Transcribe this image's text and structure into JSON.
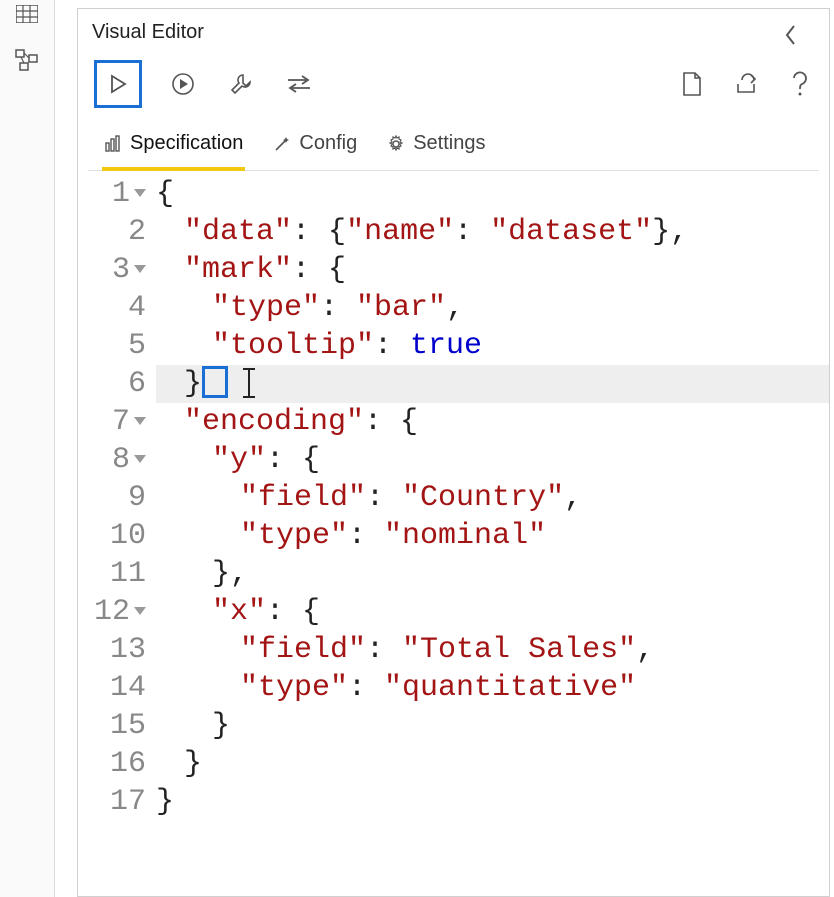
{
  "panel": {
    "title": "Visual Editor"
  },
  "tabs": {
    "specification": "Specification",
    "config": "Config",
    "settings": "Settings"
  },
  "code": {
    "lines": [
      {
        "n": "1",
        "fold": true
      },
      {
        "n": "2",
        "fold": false
      },
      {
        "n": "3",
        "fold": true
      },
      {
        "n": "4",
        "fold": false
      },
      {
        "n": "5",
        "fold": false
      },
      {
        "n": "6",
        "fold": false
      },
      {
        "n": "7",
        "fold": true
      },
      {
        "n": "8",
        "fold": true
      },
      {
        "n": "9",
        "fold": false
      },
      {
        "n": "10",
        "fold": false
      },
      {
        "n": "11",
        "fold": false
      },
      {
        "n": "12",
        "fold": true
      },
      {
        "n": "13",
        "fold": false
      },
      {
        "n": "14",
        "fold": false
      },
      {
        "n": "15",
        "fold": false
      },
      {
        "n": "16",
        "fold": false
      },
      {
        "n": "17",
        "fold": false
      }
    ],
    "t": {
      "brace_open": "{",
      "brace_close": "}",
      "bracket_close_comma": "},",
      "close_comma": ",",
      "data_key": "\"data\"",
      "name_key": "\"name\"",
      "dataset_val": "\"dataset\"",
      "mark_key": "\"mark\"",
      "type_key": "\"type\"",
      "bar_val": "\"bar\"",
      "tooltip_key": "\"tooltip\"",
      "true_val": "true",
      "encoding_key": "\"encoding\"",
      "y_key": "\"y\"",
      "field_key": "\"field\"",
      "country_val": "\"Country\"",
      "nominal_val": "\"nominal\"",
      "x_key": "\"x\"",
      "total_sales_val": "\"Total Sales\"",
      "quant_val": "\"quantitative\"",
      "colon_sp": ": ",
      "colon_brace": ": {"
    }
  }
}
